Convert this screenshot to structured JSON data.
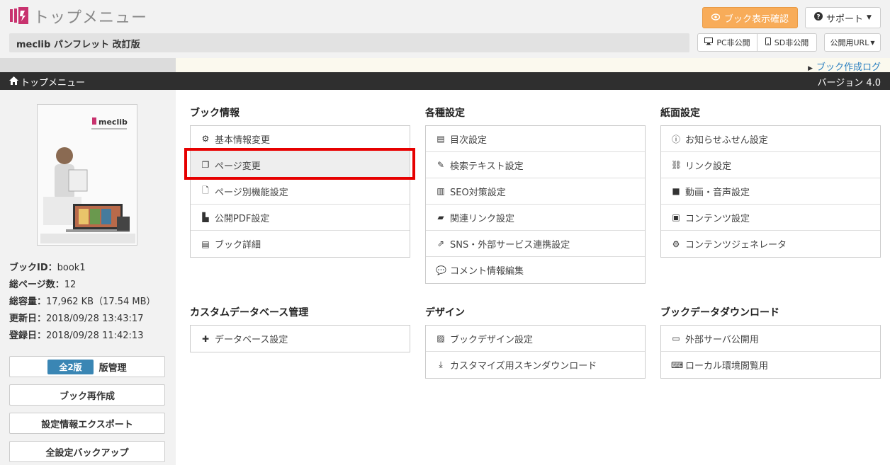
{
  "header": {
    "app_title": "トップメニュー",
    "book_title": "meclib パンフレット 改訂版",
    "preview_label": "ブック表示確認",
    "support_label": "サポート",
    "pc_label": "PC非公開",
    "sd_label": "SD非公開",
    "url_label": "公開用URL",
    "log_link": "ブック作成ログ"
  },
  "nav": {
    "breadcrumb": "トップメニュー",
    "version": "バージョン 4.0"
  },
  "sidebar": {
    "book_id_label": "ブックID：",
    "book_id": "book1",
    "pages_label": "総ページ数：",
    "pages": "12",
    "size_label": "総容量：",
    "size": "17,962 KB（17.54 MB）",
    "updated_label": "更新日：",
    "updated": "2018/09/28 13:43:17",
    "created_label": "登録日：",
    "created": "2018/09/28 11:42:13",
    "version_badge": "全2版",
    "version_manage": "版管理",
    "rebuild": "ブック再作成",
    "export": "設定情報エクスポート",
    "backup": "全設定バックアップ",
    "cover_logo": "meclib"
  },
  "sections": {
    "book_info": {
      "title": "ブック情報",
      "items": [
        "基本情報変更",
        "ページ変更",
        "ページ別機能設定",
        "公開PDF設定",
        "ブック詳細"
      ]
    },
    "settings": {
      "title": "各種設定",
      "items": [
        "目次設定",
        "検索テキスト設定",
        "SEO対策設定",
        "関連リンク設定",
        "SNS・外部サービス連携設定",
        "コメント情報編集"
      ]
    },
    "page_settings": {
      "title": "紙面設定",
      "items": [
        "お知らせふせん設定",
        "リンク設定",
        "動画・音声設定",
        "コンテンツ設定",
        "コンテンツジェネレータ"
      ]
    },
    "custom_db": {
      "title": "カスタムデータベース管理",
      "items": [
        "データベース設定"
      ]
    },
    "design": {
      "title": "デザイン",
      "items": [
        "ブックデザイン設定",
        "カスタマイズ用スキンダウンロード"
      ]
    },
    "download": {
      "title": "ブックデータダウンロード",
      "items": [
        "外部サーバ公開用",
        "ローカル環境閲覧用"
      ]
    }
  }
}
